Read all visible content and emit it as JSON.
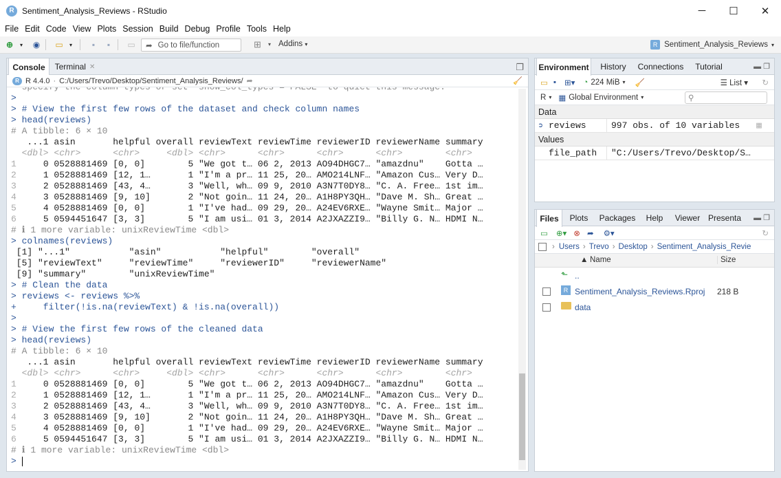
{
  "window": {
    "title": "Sentiment_Analysis_Reviews - RStudio",
    "minimize": "─",
    "maximize": "☐",
    "close": "✕"
  },
  "menu": [
    "File",
    "Edit",
    "Code",
    "View",
    "Plots",
    "Session",
    "Build",
    "Debug",
    "Profile",
    "Tools",
    "Help"
  ],
  "toolbar": {
    "goto_placeholder": "Go to file/function",
    "addins_label": "Addins",
    "project_label": "Sentiment_Analysis_Reviews"
  },
  "console_pane": {
    "tabs": [
      "Console",
      "Terminal"
    ],
    "r_version": "R 4.4.0",
    "working_dir": "C:/Users/Trevo/Desktop/Sentiment_Analysis_Reviews/",
    "lines": [
      {
        "t": "cm",
        "s": "  specify the column types or set `show_col_types = FALSE` to quiet this message."
      },
      {
        "t": "pr",
        "s": ">"
      },
      {
        "t": "pr",
        "s": "> # View the first few rows of the dataset and check column names"
      },
      {
        "t": "pr",
        "s": "> head(reviews)"
      },
      {
        "t": "cm",
        "s": "# A tibble: 6 × 10"
      },
      {
        "t": "pl",
        "s": "   ...1 asin       helpful overall reviewText reviewTime reviewerID reviewerName summary"
      },
      {
        "t": "ty",
        "s": "  <dbl> <chr>      <chr>     <dbl> <chr>      <chr>      <chr>      <chr>        <chr>"
      },
      {
        "t": "row",
        "n": "1",
        "s": "     0 0528881469 [0, 0]        5 \"We got t… 06 2, 2013 AO94DHGC7… \"amazdnu\"    Gotta …"
      },
      {
        "t": "row",
        "n": "2",
        "s": "     1 0528881469 [12, 1…       1 \"I'm a pr… 11 25, 20… AMO214LNF… \"Amazon Cus… Very D…"
      },
      {
        "t": "row",
        "n": "3",
        "s": "     2 0528881469 [43, 4…       3 \"Well, wh… 09 9, 2010 A3N7T0DY8… \"C. A. Free… 1st im…"
      },
      {
        "t": "row",
        "n": "4",
        "s": "     3 0528881469 [9, 10]       2 \"Not goin… 11 24, 20… A1H8PY3QH… \"Dave M. Sh… Great …"
      },
      {
        "t": "row",
        "n": "5",
        "s": "     4 0528881469 [0, 0]        1 \"I've had… 09 29, 20… A24EV6RXE… \"Wayne Smit… Major …"
      },
      {
        "t": "row",
        "n": "6",
        "s": "     5 0594451647 [3, 3]        5 \"I am usi… 01 3, 2014 A2JXAZZI9… \"Billy G. N… HDMI N…"
      },
      {
        "t": "cm",
        "s": "# ℹ 1 more variable: unixReviewTime <dbl>"
      },
      {
        "t": "pr",
        "s": "> colnames(reviews)"
      },
      {
        "t": "pl",
        "s": " [1] \"...1\"           \"asin\"           \"helpful\"        \"overall\""
      },
      {
        "t": "pl",
        "s": " [5] \"reviewText\"     \"reviewTime\"     \"reviewerID\"     \"reviewerName\""
      },
      {
        "t": "pl",
        "s": " [9] \"summary\"        \"unixReviewTime\""
      },
      {
        "t": "pr",
        "s": "> # Clean the data"
      },
      {
        "t": "pr",
        "s": "> reviews <- reviews %>%"
      },
      {
        "t": "pr",
        "s": "+     filter(!is.na(reviewText) & !is.na(overall))"
      },
      {
        "t": "pr",
        "s": ">"
      },
      {
        "t": "pr",
        "s": "> # View the first few rows of the cleaned data"
      },
      {
        "t": "pr",
        "s": "> head(reviews)"
      },
      {
        "t": "cm",
        "s": "# A tibble: 6 × 10"
      },
      {
        "t": "pl",
        "s": "   ...1 asin       helpful overall reviewText reviewTime reviewerID reviewerName summary"
      },
      {
        "t": "ty",
        "s": "  <dbl> <chr>      <chr>     <dbl> <chr>      <chr>      <chr>      <chr>        <chr>"
      },
      {
        "t": "row",
        "n": "1",
        "s": "     0 0528881469 [0, 0]        5 \"We got t… 06 2, 2013 AO94DHGC7… \"amazdnu\"    Gotta …"
      },
      {
        "t": "row",
        "n": "2",
        "s": "     1 0528881469 [12, 1…       1 \"I'm a pr… 11 25, 20… AMO214LNF… \"Amazon Cus… Very D…"
      },
      {
        "t": "row",
        "n": "3",
        "s": "     2 0528881469 [43, 4…       3 \"Well, wh… 09 9, 2010 A3N7T0DY8… \"C. A. Free… 1st im…"
      },
      {
        "t": "row",
        "n": "4",
        "s": "     3 0528881469 [9, 10]       2 \"Not goin… 11 24, 20… A1H8PY3QH… \"Dave M. Sh… Great …"
      },
      {
        "t": "row",
        "n": "5",
        "s": "     4 0528881469 [0, 0]        1 \"I've had… 09 29, 20… A24EV6RXE… \"Wayne Smit… Major …"
      },
      {
        "t": "row",
        "n": "6",
        "s": "     5 0594451647 [3, 3]        5 \"I am usi… 01 3, 2014 A2JXAZZI9… \"Billy G. N… HDMI N…"
      },
      {
        "t": "cm",
        "s": "# ℹ 1 more variable: unixReviewTime <dbl>"
      },
      {
        "t": "pr",
        "s": "> "
      }
    ]
  },
  "env_pane": {
    "tabs": [
      "Environment",
      "History",
      "Connections",
      "Tutorial"
    ],
    "memory": "224 MiB",
    "list_label": "List",
    "lang": "R",
    "scope": "Global Environment",
    "data_header": "Data",
    "values_header": "Values",
    "data_rows": [
      {
        "name": "reviews",
        "value": "997 obs. of 10 variables"
      }
    ],
    "value_rows": [
      {
        "name": "file_path",
        "value": "\"C:/Users/Trevo/Desktop/S…"
      }
    ]
  },
  "files_pane": {
    "tabs": [
      "Files",
      "Plots",
      "Packages",
      "Help",
      "Viewer",
      "Presenta"
    ],
    "breadcrumb": [
      "Users",
      "Trevo",
      "Desktop",
      "Sentiment_Analysis_Revie"
    ],
    "col_name": "Name",
    "col_size": "Size",
    "up_label": "..",
    "files": [
      {
        "name": "Sentiment_Analysis_Reviews.Rproj",
        "size": "218 B"
      },
      {
        "name": "data",
        "size": ""
      }
    ]
  }
}
